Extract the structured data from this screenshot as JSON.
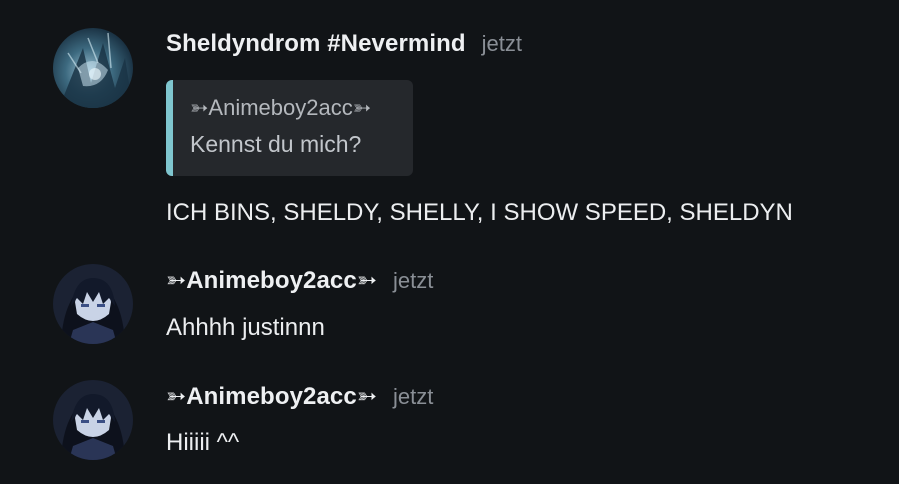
{
  "messages": [
    {
      "author": "Sheldyndrom #Nevermind",
      "timestamp": "jetzt",
      "avatar_icon": "dark-artwork-avatar-icon",
      "reply": {
        "author": "➳Animeboy2acc➳",
        "text": "Kennst du mich?"
      },
      "text": "ICH BINS, SHELDY, SHELLY, I SHOW SPEED, SHELDYN"
    },
    {
      "author": "➳Animeboy2acc➳",
      "timestamp": "jetzt",
      "avatar_icon": "anime-hooded-boy-avatar-icon",
      "text": "Ahhhh justinnn"
    },
    {
      "author": "➳Animeboy2acc➳",
      "timestamp": "jetzt",
      "avatar_icon": "anime-hooded-boy-avatar-icon",
      "text": "Hiiiii ^^"
    }
  ],
  "colors": {
    "background": "#111417",
    "reply_accent": "#7fc6cf",
    "reply_background": "#25282c",
    "timestamp": "#8a8f96"
  }
}
